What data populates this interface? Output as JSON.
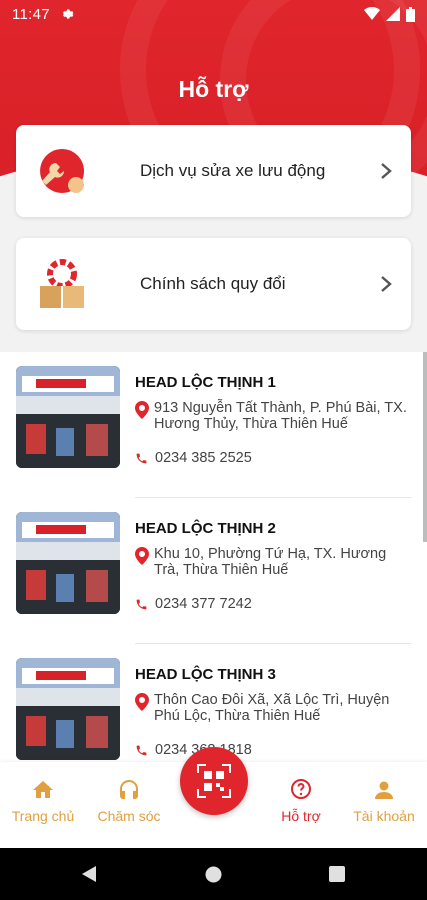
{
  "status": {
    "time": "11:47"
  },
  "header": {
    "title": "Hỗ trợ"
  },
  "menu": [
    {
      "label": "Dịch vụ sửa xe lưu động",
      "icon": "wrench-service-icon"
    },
    {
      "label": "Chính sách quy đổi",
      "icon": "exchange-policy-icon"
    }
  ],
  "dealers": [
    {
      "name": "HEAD LỘC THỊNH 1",
      "address": "913 Nguyễn Tất Thành, P. Phú Bài, TX. Hương Thủy, Thừa Thiên Huế",
      "phone": "0234 385 2525"
    },
    {
      "name": "HEAD LỘC THỊNH 2",
      "address": "Khu 10, Phường Tứ Hạ, TX. Hương Trà, Thừa Thiên Huế",
      "phone": "0234 377 7242"
    },
    {
      "name": "HEAD LỘC THỊNH 3",
      "address": "Thôn Cao Đôi Xã, Xã Lộc Trì, Huyện Phú Lộc, Thừa Thiên Huế",
      "phone": "0234 368 1818"
    }
  ],
  "nav": {
    "home": "Trang chủ",
    "care": "Chăm sóc",
    "support": "Hỗ trợ",
    "account": "Tài khoản"
  },
  "colors": {
    "brand_red": "#e0262c",
    "nav_inactive": "#e0a040"
  }
}
